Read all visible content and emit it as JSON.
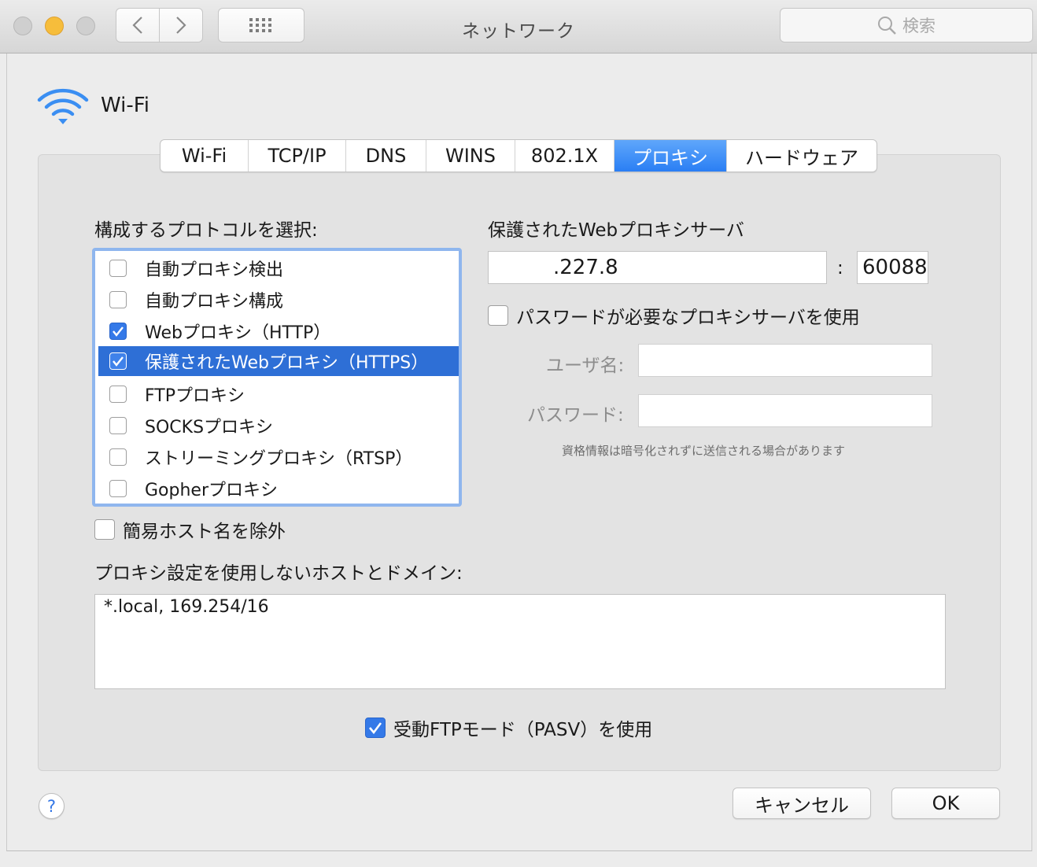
{
  "window": {
    "title": "ネットワーク",
    "search_placeholder": "検索"
  },
  "interface": {
    "name": "Wi-Fi",
    "icon": "wifi-icon"
  },
  "tabs": [
    {
      "label": "Wi-Fi",
      "active": false
    },
    {
      "label": "TCP/IP",
      "active": false
    },
    {
      "label": "DNS",
      "active": false
    },
    {
      "label": "WINS",
      "active": false
    },
    {
      "label": "802.1X",
      "active": false
    },
    {
      "label": "プロキシ",
      "active": true
    },
    {
      "label": "ハードウェア",
      "active": false
    }
  ],
  "protocols": {
    "heading": "構成するプロトコルを選択:",
    "items": [
      {
        "label": "自動プロキシ検出",
        "checked": false,
        "selected": false
      },
      {
        "label": "自動プロキシ構成",
        "checked": false,
        "selected": false
      },
      {
        "label": "Webプロキシ（HTTP）",
        "checked": true,
        "selected": false
      },
      {
        "label": "保護されたWebプロキシ（HTTPS）",
        "checked": true,
        "selected": true
      },
      {
        "label": "FTPプロキシ",
        "checked": false,
        "selected": false
      },
      {
        "label": "SOCKSプロキシ",
        "checked": false,
        "selected": false
      },
      {
        "label": "ストリーミングプロキシ（RTSP）",
        "checked": false,
        "selected": false
      },
      {
        "label": "Gopherプロキシ",
        "checked": false,
        "selected": false
      }
    ]
  },
  "server": {
    "heading": "保護されたWebプロキシサーバ",
    "address": ".227.8",
    "separator": ":",
    "port": "60088",
    "password_required_label": "パスワードが必要なプロキシサーバを使用",
    "password_required": false,
    "username_label": "ユーザ名:",
    "username_value": "",
    "password_label": "パスワード:",
    "password_value": "",
    "warning": "資格情報は暗号化されずに送信される場合があります"
  },
  "exclude_simple": {
    "label": "簡易ホスト名を除外",
    "checked": false
  },
  "bypass": {
    "heading": "プロキシ設定を使用しないホストとドメイン:",
    "value": "*.local, 169.254/16"
  },
  "pasv": {
    "label": "受動FTPモード（PASV）を使用",
    "checked": true
  },
  "buttons": {
    "cancel": "キャンセル",
    "ok": "OK",
    "help": "?"
  },
  "colors": {
    "accent": "#2e6fd6",
    "tab_active": "#3b8bf6",
    "window_bg": "#ececec",
    "close": "#cfcfcf",
    "minimize": "#f6bd3b",
    "maximize": "#cfcfcf"
  }
}
